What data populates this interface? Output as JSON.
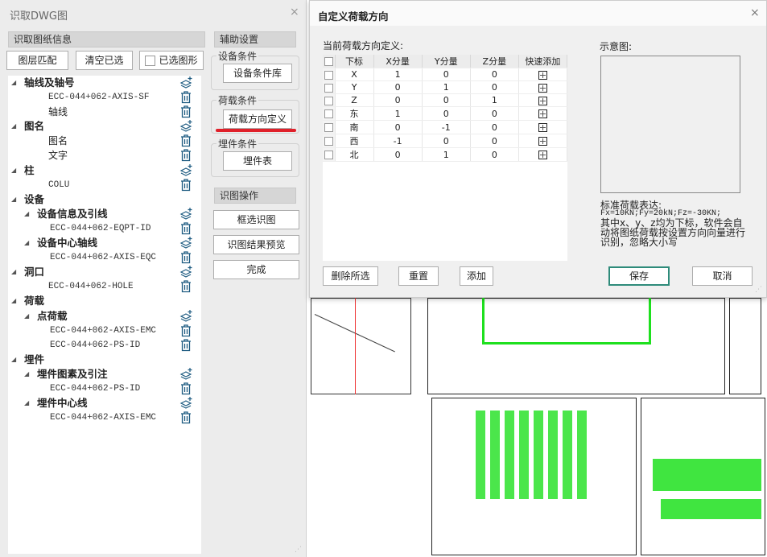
{
  "left_panel": {
    "title": "识取DWG图",
    "info_header": "识取图纸信息",
    "buttons": {
      "layer_match": "图层匹配",
      "clear_selected": "清空已选",
      "selected_shapes": "已选图形"
    },
    "tree": [
      {
        "label": "轴线及轴号",
        "level": 0,
        "kind": "group",
        "icon": "layers-add-icon"
      },
      {
        "label": "ECC-044+062-AXIS-SF",
        "level": 1,
        "kind": "layer",
        "icon": "trash-icon"
      },
      {
        "label": "轴线",
        "level": 1,
        "kind": "text",
        "icon": "trash-icon"
      },
      {
        "label": "图名",
        "level": 0,
        "kind": "group",
        "icon": "layers-add-icon"
      },
      {
        "label": "图名",
        "level": 1,
        "kind": "text",
        "icon": "trash-icon"
      },
      {
        "label": "文字",
        "level": 1,
        "kind": "text",
        "icon": "trash-icon"
      },
      {
        "label": "柱",
        "level": 0,
        "kind": "group",
        "icon": "layers-add-icon"
      },
      {
        "label": "COLU",
        "level": 1,
        "kind": "layer",
        "icon": "trash-icon"
      },
      {
        "label": "设备",
        "level": 0,
        "kind": "group",
        "icon": ""
      },
      {
        "label": "设备信息及引线",
        "level": 1,
        "kind": "group",
        "icon": "layers-add-icon"
      },
      {
        "label": "ECC-044+062-EQPT-ID",
        "level": 2,
        "kind": "layer",
        "icon": "trash-icon"
      },
      {
        "label": "设备中心轴线",
        "level": 1,
        "kind": "group",
        "icon": "layers-add-icon"
      },
      {
        "label": "ECC-044+062-AXIS-EQC",
        "level": 2,
        "kind": "layer",
        "icon": "trash-icon"
      },
      {
        "label": "洞口",
        "level": 0,
        "kind": "group",
        "icon": "layers-add-icon"
      },
      {
        "label": "ECC-044+062-HOLE",
        "level": 1,
        "kind": "layer",
        "icon": "trash-icon"
      },
      {
        "label": "荷载",
        "level": 0,
        "kind": "group",
        "icon": ""
      },
      {
        "label": "点荷载",
        "level": 1,
        "kind": "group",
        "icon": "layers-add-icon"
      },
      {
        "label": "ECC-044+062-AXIS-EMC",
        "level": 2,
        "kind": "layer",
        "icon": "trash-icon"
      },
      {
        "label": "ECC-044+062-PS-ID",
        "level": 2,
        "kind": "layer",
        "icon": "trash-icon"
      },
      {
        "label": "埋件",
        "level": 0,
        "kind": "group",
        "icon": ""
      },
      {
        "label": "埋件图素及引注",
        "level": 1,
        "kind": "group",
        "icon": "layers-add-icon"
      },
      {
        "label": "ECC-044+062-PS-ID",
        "level": 2,
        "kind": "layer",
        "icon": "trash-icon"
      },
      {
        "label": "埋件中心线",
        "level": 1,
        "kind": "group",
        "icon": "layers-add-icon"
      },
      {
        "label": "ECC-044+062-AXIS-EMC",
        "level": 2,
        "kind": "layer",
        "icon": "trash-icon"
      }
    ],
    "aux_header": "辅助设置",
    "equip_group": "设备条件",
    "equip_btn": "设备条件库",
    "load_group": "荷载条件",
    "load_btn": "荷载方向定义",
    "embed_group": "埋件条件",
    "embed_btn": "埋件表",
    "ops_header": "识图操作",
    "ops": {
      "box_select": "框选识图",
      "preview": "识图结果预览",
      "done": "完成"
    }
  },
  "dialog": {
    "title": "自定义荷载方向",
    "table_label": "当前荷载方向定义:",
    "columns": [
      "下标",
      "X分量",
      "Y分量",
      "Z分量",
      "快速添加"
    ],
    "rows": [
      [
        "X",
        "1",
        "0",
        "0"
      ],
      [
        "Y",
        "0",
        "1",
        "0"
      ],
      [
        "Z",
        "0",
        "0",
        "1"
      ],
      [
        "东",
        "1",
        "0",
        "0"
      ],
      [
        "南",
        "0",
        "-1",
        "0"
      ],
      [
        "西",
        "-1",
        "0",
        "0"
      ],
      [
        "北",
        "0",
        "1",
        "0"
      ]
    ],
    "preview_label": "示意图:",
    "note_title": "标准荷载表达:",
    "note_example": "Fx=10KN;Fy=20kN;Fz=-30KN;",
    "note_body": "其中x、y、z均为下标，软件会自动将图纸荷载按设置方向向量进行识别，忽略大小写",
    "buttons": {
      "delete": "删除所选",
      "reset": "重置",
      "add": "添加",
      "save": "保存",
      "cancel": "取消"
    },
    "save_border_color": "#2e8b7a"
  },
  "accent_underline": "#e0202a"
}
